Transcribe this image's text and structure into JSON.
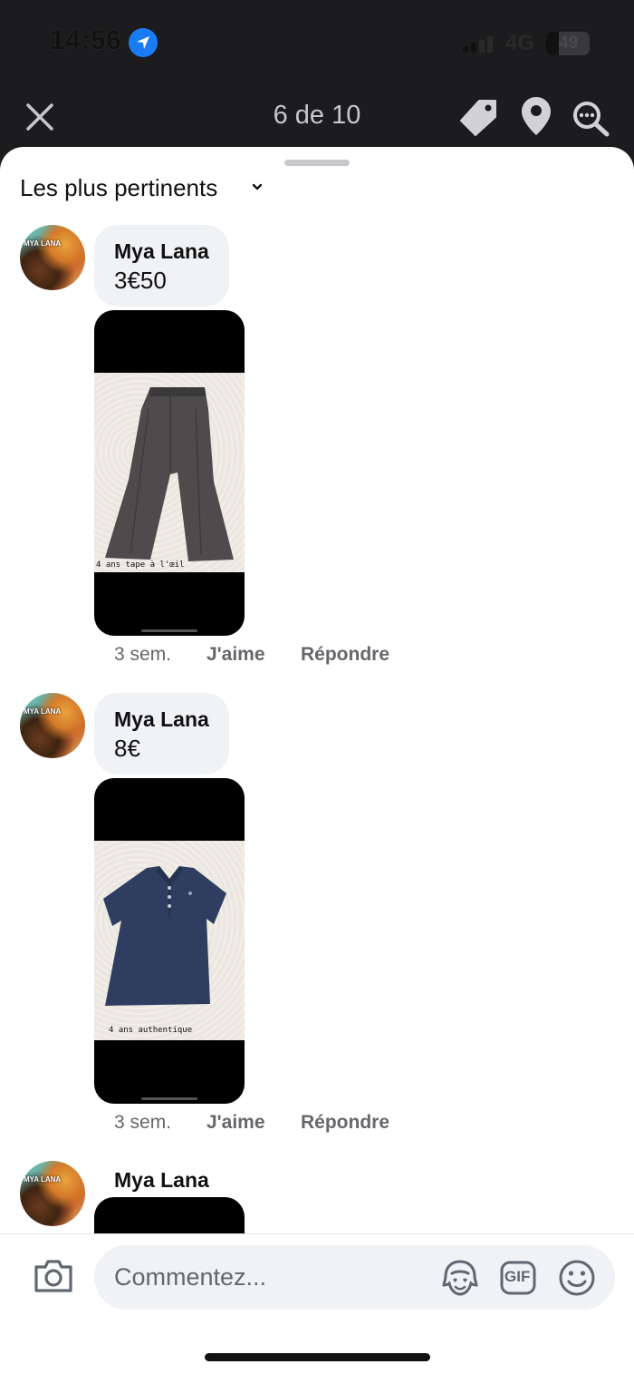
{
  "status_bar": {
    "time": "14:56",
    "network": "4G",
    "battery": "49"
  },
  "header": {
    "counter": "6 de 10"
  },
  "sort": {
    "label": "Les plus pertinents"
  },
  "comments": [
    {
      "author": "Mya Lana",
      "text": "3€50",
      "photo_caption": "4 ans tape à l'œil",
      "time": "3 sem.",
      "like": "J'aime",
      "reply": "Répondre"
    },
    {
      "author": "Mya Lana",
      "text": "8€",
      "photo_caption": "4 ans authentique",
      "time": "3 sem.",
      "like": "J'aime",
      "reply": "Répondre"
    },
    {
      "author": "Mya Lana"
    }
  ],
  "avatar_text": "MYA LANA",
  "composer": {
    "placeholder": "Commentez...",
    "gif_label": "GIF"
  },
  "colors": {
    "accent": "#1a7cf5",
    "bubble": "#f0f2f5",
    "meta": "#65676b",
    "dark_header": "#1c1c1e"
  }
}
